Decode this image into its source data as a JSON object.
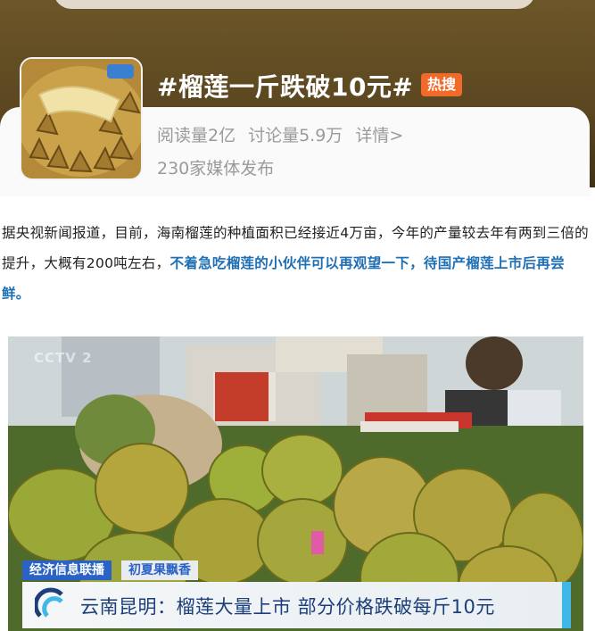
{
  "topic": {
    "title": "#榴莲一斤跌破10元#",
    "badge": "热搜",
    "stats": {
      "reads": "阅读量2亿",
      "discussions": "讨论量5.9万",
      "details": "详情>"
    },
    "media_count": "230家媒体发布"
  },
  "article": {
    "text": "据央视新闻报道，目前，海南榴莲的种植面积已经接近4万亩，今年的产量较去年有两到三倍的提升，大概有200吨左右，",
    "highlight": "不着急吃榴莲的小伙伴可以再观望一下，待国产榴莲上市后再尝鲜。"
  },
  "video": {
    "watermark": "CCTV 2",
    "program_tag": "经济信息联播",
    "segment_tag": "初夏果飘香",
    "headline": "云南昆明：榴莲大量上市  部分价格跌破每斤10元"
  },
  "colors": {
    "badge": "#f06b2a",
    "highlight": "#1e6fb4",
    "tag": "#2a62c6",
    "accent": "#3fb8e8"
  }
}
